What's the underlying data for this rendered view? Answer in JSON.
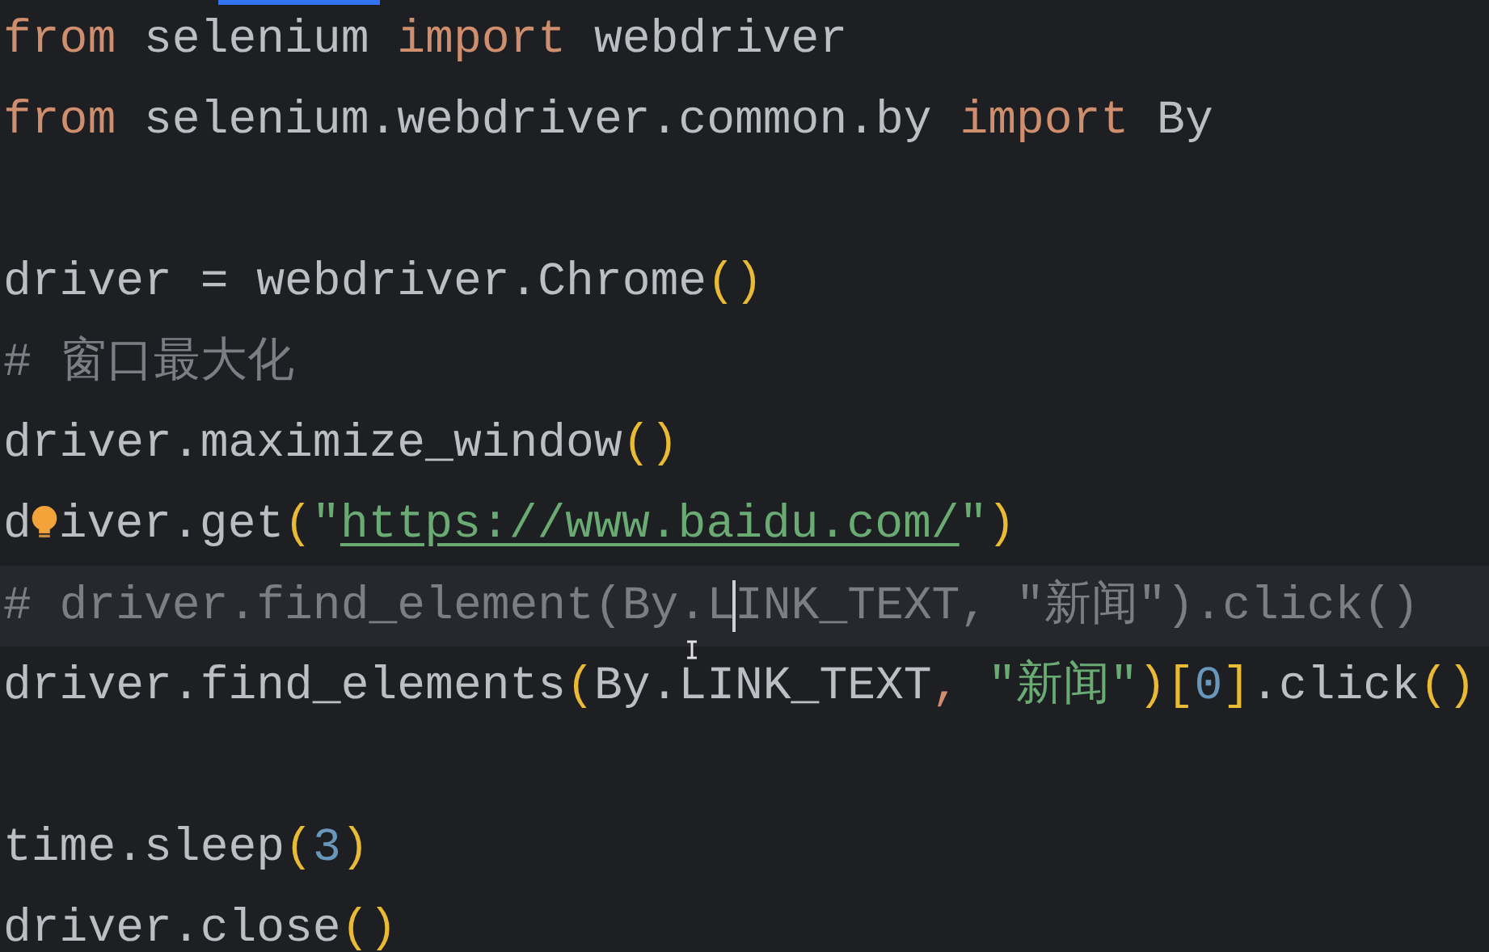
{
  "editor": {
    "lines": [
      {
        "kind": "code",
        "current": false,
        "tokens": [
          {
            "kind": "keyword",
            "text": "from"
          },
          {
            "kind": "plain",
            "text": " selenium "
          },
          {
            "kind": "keyword",
            "text": "import"
          },
          {
            "kind": "plain",
            "text": " webdriver"
          }
        ]
      },
      {
        "kind": "code",
        "current": false,
        "tokens": [
          {
            "kind": "keyword",
            "text": "from"
          },
          {
            "kind": "plain",
            "text": " selenium.webdriver.common.by "
          },
          {
            "kind": "keyword",
            "text": "import"
          },
          {
            "kind": "plain",
            "text": " By"
          }
        ]
      },
      {
        "kind": "blank",
        "current": false
      },
      {
        "kind": "code",
        "current": false,
        "tokens": [
          {
            "kind": "plain",
            "text": "driver = webdriver.Chrome"
          },
          {
            "kind": "paren",
            "text": "()"
          }
        ]
      },
      {
        "kind": "code",
        "current": false,
        "tokens": [
          {
            "kind": "comment",
            "text": "# 窗口最大化"
          }
        ]
      },
      {
        "kind": "code",
        "current": false,
        "tokens": [
          {
            "kind": "plain",
            "text": "driver.maximize_window"
          },
          {
            "kind": "paren",
            "text": "()"
          }
        ]
      },
      {
        "kind": "code",
        "current": false,
        "tokens": [
          {
            "kind": "plain",
            "text": "d"
          },
          {
            "kind": "bulb"
          },
          {
            "kind": "plain",
            "text": "iver.get"
          },
          {
            "kind": "paren",
            "text": "("
          },
          {
            "kind": "string",
            "text": "\""
          },
          {
            "kind": "link",
            "text": "https://www.baidu.com/"
          },
          {
            "kind": "string",
            "text": "\""
          },
          {
            "kind": "paren",
            "text": ")"
          }
        ]
      },
      {
        "kind": "code",
        "current": true,
        "tokens": [
          {
            "kind": "comment",
            "text": "# driver.find_element(By.L"
          },
          {
            "kind": "caret"
          },
          {
            "kind": "comment",
            "text": "INK_TEXT, \"新闻\").click()"
          }
        ]
      },
      {
        "kind": "code",
        "current": false,
        "pointer": true,
        "tokens": [
          {
            "kind": "plain",
            "text": "driver.find_elements"
          },
          {
            "kind": "paren",
            "text": "("
          },
          {
            "kind": "plain",
            "text": "By.LINK_TEXT"
          },
          {
            "kind": "keyword",
            "text": ", "
          },
          {
            "kind": "string",
            "text": "\"新闻\""
          },
          {
            "kind": "paren",
            "text": ")["
          },
          {
            "kind": "number",
            "text": "0"
          },
          {
            "kind": "paren",
            "text": "]"
          },
          {
            "kind": "plain",
            "text": ".click"
          },
          {
            "kind": "paren",
            "text": "()"
          }
        ]
      },
      {
        "kind": "blank",
        "current": false
      },
      {
        "kind": "code",
        "current": false,
        "tokens": [
          {
            "kind": "plain",
            "text": "time.sleep"
          },
          {
            "kind": "paren",
            "text": "("
          },
          {
            "kind": "number",
            "text": "3"
          },
          {
            "kind": "paren",
            "text": ")"
          }
        ]
      },
      {
        "kind": "code",
        "current": false,
        "tokens": [
          {
            "kind": "plain",
            "text": "driver.close"
          },
          {
            "kind": "paren",
            "text": "()"
          }
        ]
      }
    ]
  }
}
